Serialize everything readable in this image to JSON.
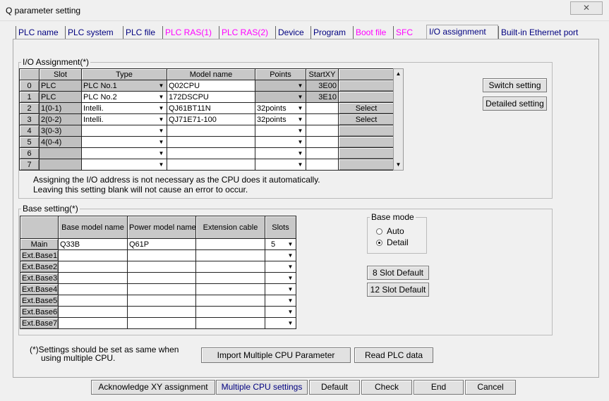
{
  "window": {
    "title": "Q parameter setting",
    "close": "✕"
  },
  "tabs": [
    {
      "label": "PLC name",
      "color": "navy"
    },
    {
      "label": "PLC system",
      "color": "navy"
    },
    {
      "label": "PLC file",
      "color": "navy"
    },
    {
      "label": "PLC RAS(1)",
      "color": "pink"
    },
    {
      "label": "PLC RAS(2)",
      "color": "pink"
    },
    {
      "label": "Device",
      "color": "navy"
    },
    {
      "label": "Program",
      "color": "navy"
    },
    {
      "label": "Boot file",
      "color": "pink"
    },
    {
      "label": "SFC",
      "color": "pink"
    },
    {
      "label": "I/O assignment",
      "color": "navy",
      "active": true
    },
    {
      "label": "Built-in Ethernet port",
      "color": "navy"
    }
  ],
  "io": {
    "label": "I/O Assignment(*)",
    "headers": [
      "",
      "Slot",
      "Type",
      "Model name",
      "Points",
      "StartXY",
      ""
    ],
    "rows": [
      {
        "no": "0",
        "slot": "PLC",
        "type": "PLC No.1",
        "model": "Q02CPU",
        "points": "",
        "start": "3E00",
        "btn": ""
      },
      {
        "no": "1",
        "slot": "PLC",
        "type": "PLC No.2",
        "model": "172DSCPU",
        "points": "",
        "start": "3E10",
        "btn": ""
      },
      {
        "no": "2",
        "slot": "1(0-1)",
        "type": "Intelli.",
        "model": "QJ61BT11N",
        "points": "32points",
        "start": "",
        "btn": "Select"
      },
      {
        "no": "3",
        "slot": "2(0-2)",
        "type": "Intelli.",
        "model": "QJ71E71-100",
        "points": "32points",
        "start": "",
        "btn": "Select"
      },
      {
        "no": "4",
        "slot": "3(0-3)",
        "type": "",
        "model": "",
        "points": "",
        "start": "",
        "btn": ""
      },
      {
        "no": "5",
        "slot": "4(0-4)",
        "type": "",
        "model": "",
        "points": "",
        "start": "",
        "btn": ""
      },
      {
        "no": "6",
        "slot": "",
        "type": "",
        "model": "",
        "points": "",
        "start": "",
        "btn": ""
      },
      {
        "no": "7",
        "slot": "",
        "type": "",
        "model": "",
        "points": "",
        "start": "",
        "btn": ""
      }
    ],
    "note1": "Assigning the I/O address is not necessary as the CPU does it automatically.",
    "note2": "Leaving this setting blank will not cause an error to occur.",
    "switch": "Switch setting",
    "detailed": "Detailed setting"
  },
  "base": {
    "label": "Base setting(*)",
    "headers": [
      "",
      "Base model name",
      "Power model name",
      "Extension cable",
      "Slots"
    ],
    "rows": [
      {
        "name": "Main",
        "base": "Q33B",
        "power": "Q61P",
        "cable": "",
        "slots": "5"
      },
      {
        "name": "Ext.Base1",
        "base": "",
        "power": "",
        "cable": "",
        "slots": ""
      },
      {
        "name": "Ext.Base2",
        "base": "",
        "power": "",
        "cable": "",
        "slots": ""
      },
      {
        "name": "Ext.Base3",
        "base": "",
        "power": "",
        "cable": "",
        "slots": ""
      },
      {
        "name": "Ext.Base4",
        "base": "",
        "power": "",
        "cable": "",
        "slots": ""
      },
      {
        "name": "Ext.Base5",
        "base": "",
        "power": "",
        "cable": "",
        "slots": ""
      },
      {
        "name": "Ext.Base6",
        "base": "",
        "power": "",
        "cable": "",
        "slots": ""
      },
      {
        "name": "Ext.Base7",
        "base": "",
        "power": "",
        "cable": "",
        "slots": ""
      }
    ],
    "mode_label": "Base mode",
    "auto": "Auto",
    "detail": "Detail",
    "selected_mode": "Detail",
    "slot8": "8 Slot Default",
    "slot12": "12 Slot Default"
  },
  "footer": {
    "note1": "(*)Settings should be set as same when",
    "note2": "using multiple CPU.",
    "import": "Import Multiple CPU Parameter",
    "read": "Read PLC data",
    "ack": "Acknowledge XY assignment",
    "multi": "Multiple CPU settings",
    "default": "Default",
    "check": "Check",
    "end": "End",
    "cancel": "Cancel"
  }
}
